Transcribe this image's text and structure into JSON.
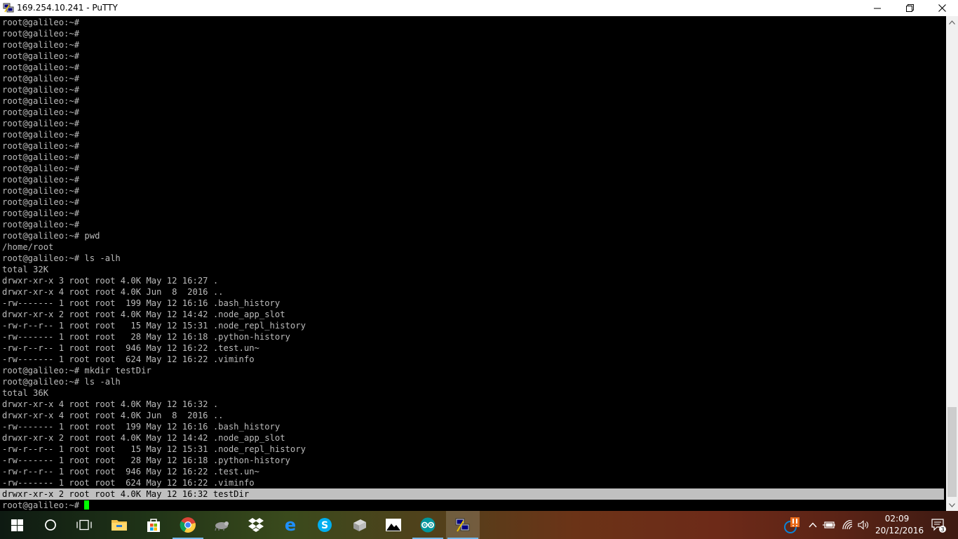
{
  "window": {
    "title": "169.254.10.241 - PuTTY"
  },
  "terminal": {
    "lines": [
      "root@galileo:~#",
      "root@galileo:~#",
      "root@galileo:~#",
      "root@galileo:~#",
      "root@galileo:~#",
      "root@galileo:~#",
      "root@galileo:~#",
      "root@galileo:~#",
      "root@galileo:~#",
      "root@galileo:~#",
      "root@galileo:~#",
      "root@galileo:~#",
      "root@galileo:~#",
      "root@galileo:~#",
      "root@galileo:~#",
      "root@galileo:~#",
      "root@galileo:~#",
      "root@galileo:~#",
      "root@galileo:~#",
      "root@galileo:~# pwd",
      "/home/root",
      "root@galileo:~# ls -alh",
      "total 32K",
      "drwxr-xr-x 3 root root 4.0K May 12 16:27 .",
      "drwxr-xr-x 4 root root 4.0K Jun  8  2016 ..",
      "-rw------- 1 root root  199 May 12 16:16 .bash_history",
      "drwxr-xr-x 2 root root 4.0K May 12 14:42 .node_app_slot",
      "-rw-r--r-- 1 root root   15 May 12 15:31 .node_repl_history",
      "-rw------- 1 root root   28 May 12 16:18 .python-history",
      "-rw-r--r-- 1 root root  946 May 12 16:22 .test.un~",
      "-rw------- 1 root root  624 May 12 16:22 .viminfo",
      "root@galileo:~# mkdir testDir",
      "root@galileo:~# ls -alh",
      "total 36K",
      "drwxr-xr-x 4 root root 4.0K May 12 16:32 .",
      "drwxr-xr-x 4 root root 4.0K Jun  8  2016 ..",
      "-rw------- 1 root root  199 May 12 16:16 .bash_history",
      "drwxr-xr-x 2 root root 4.0K May 12 14:42 .node_app_slot",
      "-rw-r--r-- 1 root root   15 May 12 15:31 .node_repl_history",
      "-rw------- 1 root root   28 May 12 16:18 .python-history",
      "-rw-r--r-- 1 root root  946 May 12 16:22 .test.un~",
      "-rw------- 1 root root  624 May 12 16:22 .viminfo"
    ],
    "selected_line": "drwxr-xr-x 2 root root 4.0K May 12 16:32 testDir",
    "prompt": "root@galileo:~# ",
    "text_color": "#bbbbbb",
    "cursor_color": "#00ff00"
  },
  "taskbar": {
    "apps": [
      {
        "name": "file-explorer",
        "icon": "folder-icon",
        "running": false
      },
      {
        "name": "store",
        "icon": "store-icon",
        "running": false
      },
      {
        "name": "chrome",
        "icon": "chrome-icon",
        "running": true
      },
      {
        "name": "app-animal",
        "icon": "animal-icon",
        "running": false
      },
      {
        "name": "dropbox",
        "icon": "dropbox-icon",
        "running": false
      },
      {
        "name": "edge",
        "icon": "edge-icon",
        "running": false
      },
      {
        "name": "skype",
        "icon": "skype-icon",
        "running": false
      },
      {
        "name": "network-app",
        "icon": "network-drive-icon",
        "running": false
      },
      {
        "name": "photos",
        "icon": "photos-icon",
        "running": false
      },
      {
        "name": "arduino",
        "icon": "arduino-icon",
        "running": true
      },
      {
        "name": "putty",
        "icon": "putty-icon",
        "running": true
      }
    ],
    "clock": {
      "time": "02:09",
      "date": "20/12/2016"
    },
    "notification_count": "3"
  }
}
